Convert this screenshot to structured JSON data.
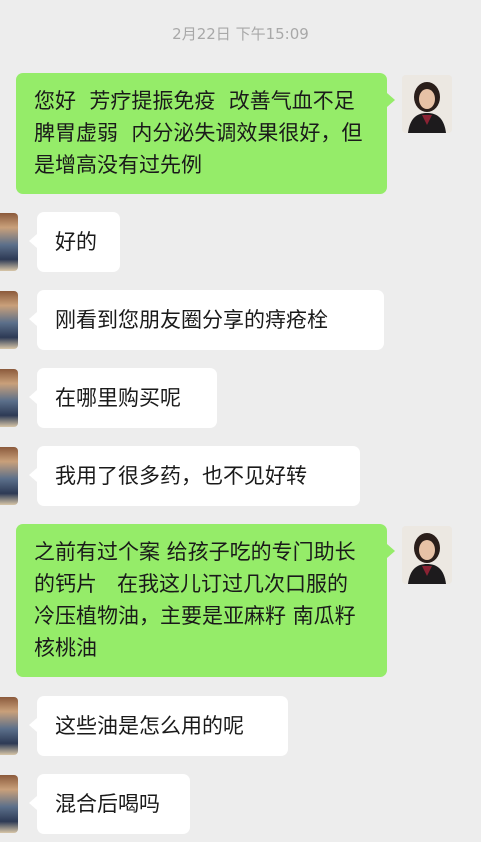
{
  "chat": {
    "timestamp": "2月22日 下午15:09",
    "messages": [
      {
        "side": "out",
        "text": "您好  芳疗提振免疫  改善气血不足  脾胃虚弱  内分泌失调效果很好，但是增高没有过先例"
      },
      {
        "side": "in",
        "text": "好的"
      },
      {
        "side": "in",
        "text": "刚看到您朋友圈分享的痔疮栓"
      },
      {
        "side": "in",
        "text": "在哪里购买呢"
      },
      {
        "side": "in",
        "text": "我用了很多药，也不见好转"
      },
      {
        "side": "out",
        "text": "之前有过个案 给孩子吃的专门助长的钙片   在我这儿订过几次口服的冷压植物油，主要是亚麻籽 南瓜籽 核桃油"
      },
      {
        "side": "in",
        "text": "这些油是怎么用的呢"
      },
      {
        "side": "in",
        "text": "混合后喝吗"
      }
    ]
  },
  "colors": {
    "background": "#ededed",
    "outgoing_bubble": "#95ec69",
    "incoming_bubble": "#ffffff",
    "timestamp_text": "#a8a8a8"
  },
  "icons": {
    "my_avatar": "avatar-woman-portrait",
    "contact_avatar": "avatar-contact-cropped"
  }
}
